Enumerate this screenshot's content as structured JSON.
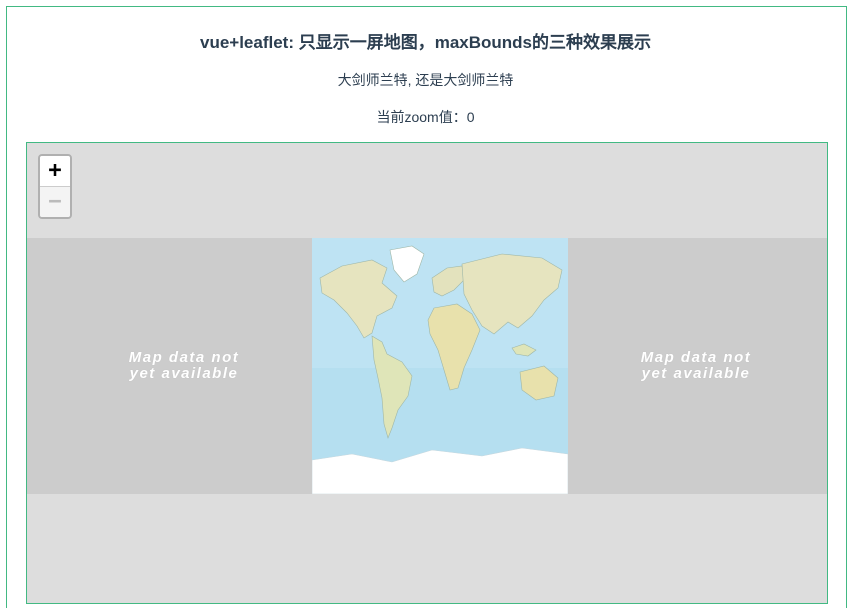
{
  "page": {
    "title": "vue+leaflet: 只显示一屏地图，maxBounds的三种效果展示",
    "subtitle": "大剑师兰特, 还是大剑师兰特",
    "zoom_label": "当前zoom值：0"
  },
  "map": {
    "zoom_in_label": "+",
    "zoom_out_label": "−",
    "unavailable_left": "Map data not yet available",
    "unavailable_right": "Map data not yet available"
  },
  "colors": {
    "accent": "#42b983",
    "text": "#2c3e50",
    "map_background": "#dddddd",
    "ocean": "#b5dff0",
    "land": "#e8e6c4",
    "ice": "#ffffff"
  }
}
